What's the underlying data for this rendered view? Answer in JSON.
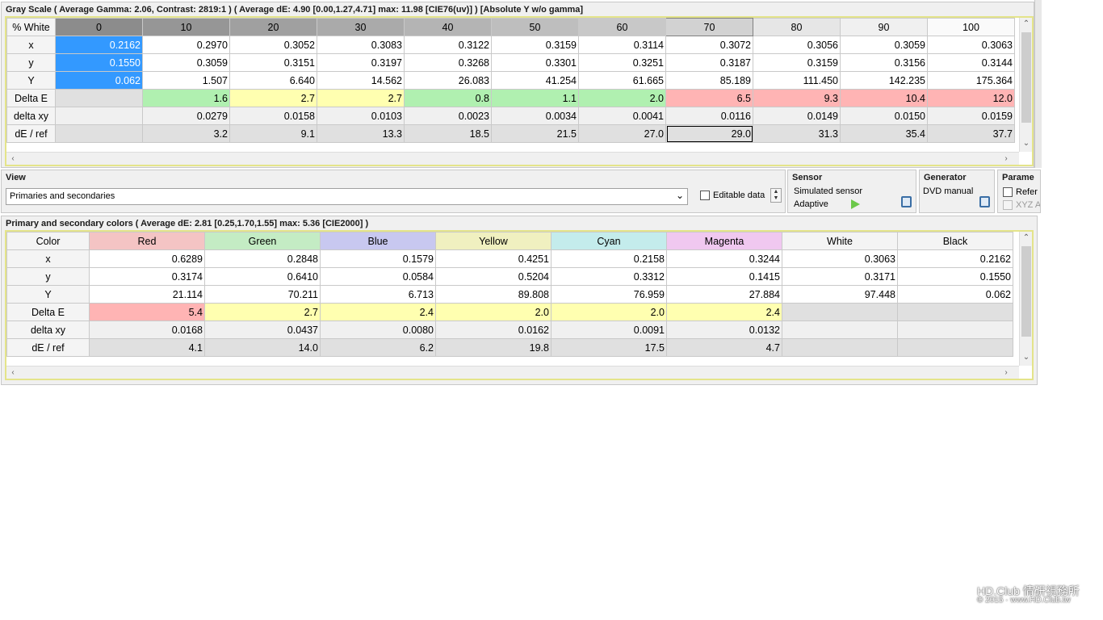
{
  "gray": {
    "title": "Gray Scale ( Average Gamma: 2.06, Contrast: 2819:1 ) ( Average dE: 4.90 [0.00,1.27,4.71] max: 11.98 [CIE76(uv)] ) [Absolute Y w/o gamma]",
    "corner": "% White",
    "columns": [
      "0",
      "10",
      "20",
      "30",
      "40",
      "50",
      "60",
      "70",
      "80",
      "90",
      "100"
    ],
    "rows": [
      {
        "label": "x",
        "cells": [
          "0.2162",
          "0.2970",
          "0.3052",
          "0.3083",
          "0.3122",
          "0.3159",
          "0.3114",
          "0.3072",
          "0.3056",
          "0.3059",
          "0.3063"
        ]
      },
      {
        "label": "y",
        "cells": [
          "0.1550",
          "0.3059",
          "0.3151",
          "0.3197",
          "0.3268",
          "0.3301",
          "0.3251",
          "0.3187",
          "0.3159",
          "0.3156",
          "0.3144"
        ]
      },
      {
        "label": "Y",
        "cells": [
          "0.062",
          "1.507",
          "6.640",
          "14.562",
          "26.083",
          "41.254",
          "61.665",
          "85.189",
          "111.450",
          "142.235",
          "175.364"
        ]
      },
      {
        "label": "Delta E",
        "cells": [
          "",
          "1.6",
          "2.7",
          "2.7",
          "0.8",
          "1.1",
          "2.0",
          "6.5",
          "9.3",
          "10.4",
          "12.0"
        ]
      },
      {
        "label": "delta xy",
        "cells": [
          "",
          "0.0279",
          "0.0158",
          "0.0103",
          "0.0023",
          "0.0034",
          "0.0041",
          "0.0116",
          "0.0149",
          "0.0150",
          "0.0159"
        ]
      },
      {
        "label": "dE / ref",
        "cells": [
          "",
          "3.2",
          "9.1",
          "13.3",
          "18.5",
          "21.5",
          "27.0",
          "29.0",
          "31.3",
          "35.4",
          "37.7"
        ]
      }
    ]
  },
  "view": {
    "title": "View",
    "selected": "Primaries and secondaries",
    "editable_label": "Editable data"
  },
  "sensor": {
    "title": "Sensor",
    "name": "Simulated sensor",
    "mode": "Adaptive"
  },
  "generator": {
    "title": "Generator",
    "name": "DVD manual"
  },
  "params": {
    "title": "Parame",
    "opt1": "Refer",
    "opt2": "XYZ A"
  },
  "prim": {
    "title": "Primary and secondary colors ( Average dE: 2.81 [0.25,1.70,1.55] max: 5.36 [CIE2000] )",
    "corner": "Color",
    "columns": [
      "Red",
      "Green",
      "Blue",
      "Yellow",
      "Cyan",
      "Magenta",
      "White",
      "Black"
    ],
    "header_colors": [
      "#f4c4c4",
      "#c4ecc4",
      "#c8c8f0",
      "#f0f0c0",
      "#c4ecec",
      "#f0c8f0",
      "#f4f4f4",
      "#f4f4f4"
    ],
    "rows": [
      {
        "label": "x",
        "cells": [
          "0.6289",
          "0.2848",
          "0.1579",
          "0.4251",
          "0.2158",
          "0.3244",
          "0.3063",
          "0.2162"
        ]
      },
      {
        "label": "y",
        "cells": [
          "0.3174",
          "0.6410",
          "0.0584",
          "0.5204",
          "0.3312",
          "0.1415",
          "0.3171",
          "0.1550"
        ]
      },
      {
        "label": "Y",
        "cells": [
          "21.114",
          "70.211",
          "6.713",
          "89.808",
          "76.959",
          "27.884",
          "97.448",
          "0.062"
        ]
      },
      {
        "label": "Delta E",
        "cells": [
          "5.4",
          "2.7",
          "2.4",
          "2.0",
          "2.0",
          "2.4",
          "",
          ""
        ]
      },
      {
        "label": "delta xy",
        "cells": [
          "0.0168",
          "0.0437",
          "0.0080",
          "0.0162",
          "0.0091",
          "0.0132",
          "",
          ""
        ]
      },
      {
        "label": "dE / ref",
        "cells": [
          "4.1",
          "14.0",
          "6.2",
          "19.8",
          "17.5",
          "4.7",
          "",
          ""
        ]
      }
    ]
  },
  "watermark": {
    "line1": "HD.Club 情研視務所",
    "line2": "© 2015 · www.HD.Club.tw"
  }
}
